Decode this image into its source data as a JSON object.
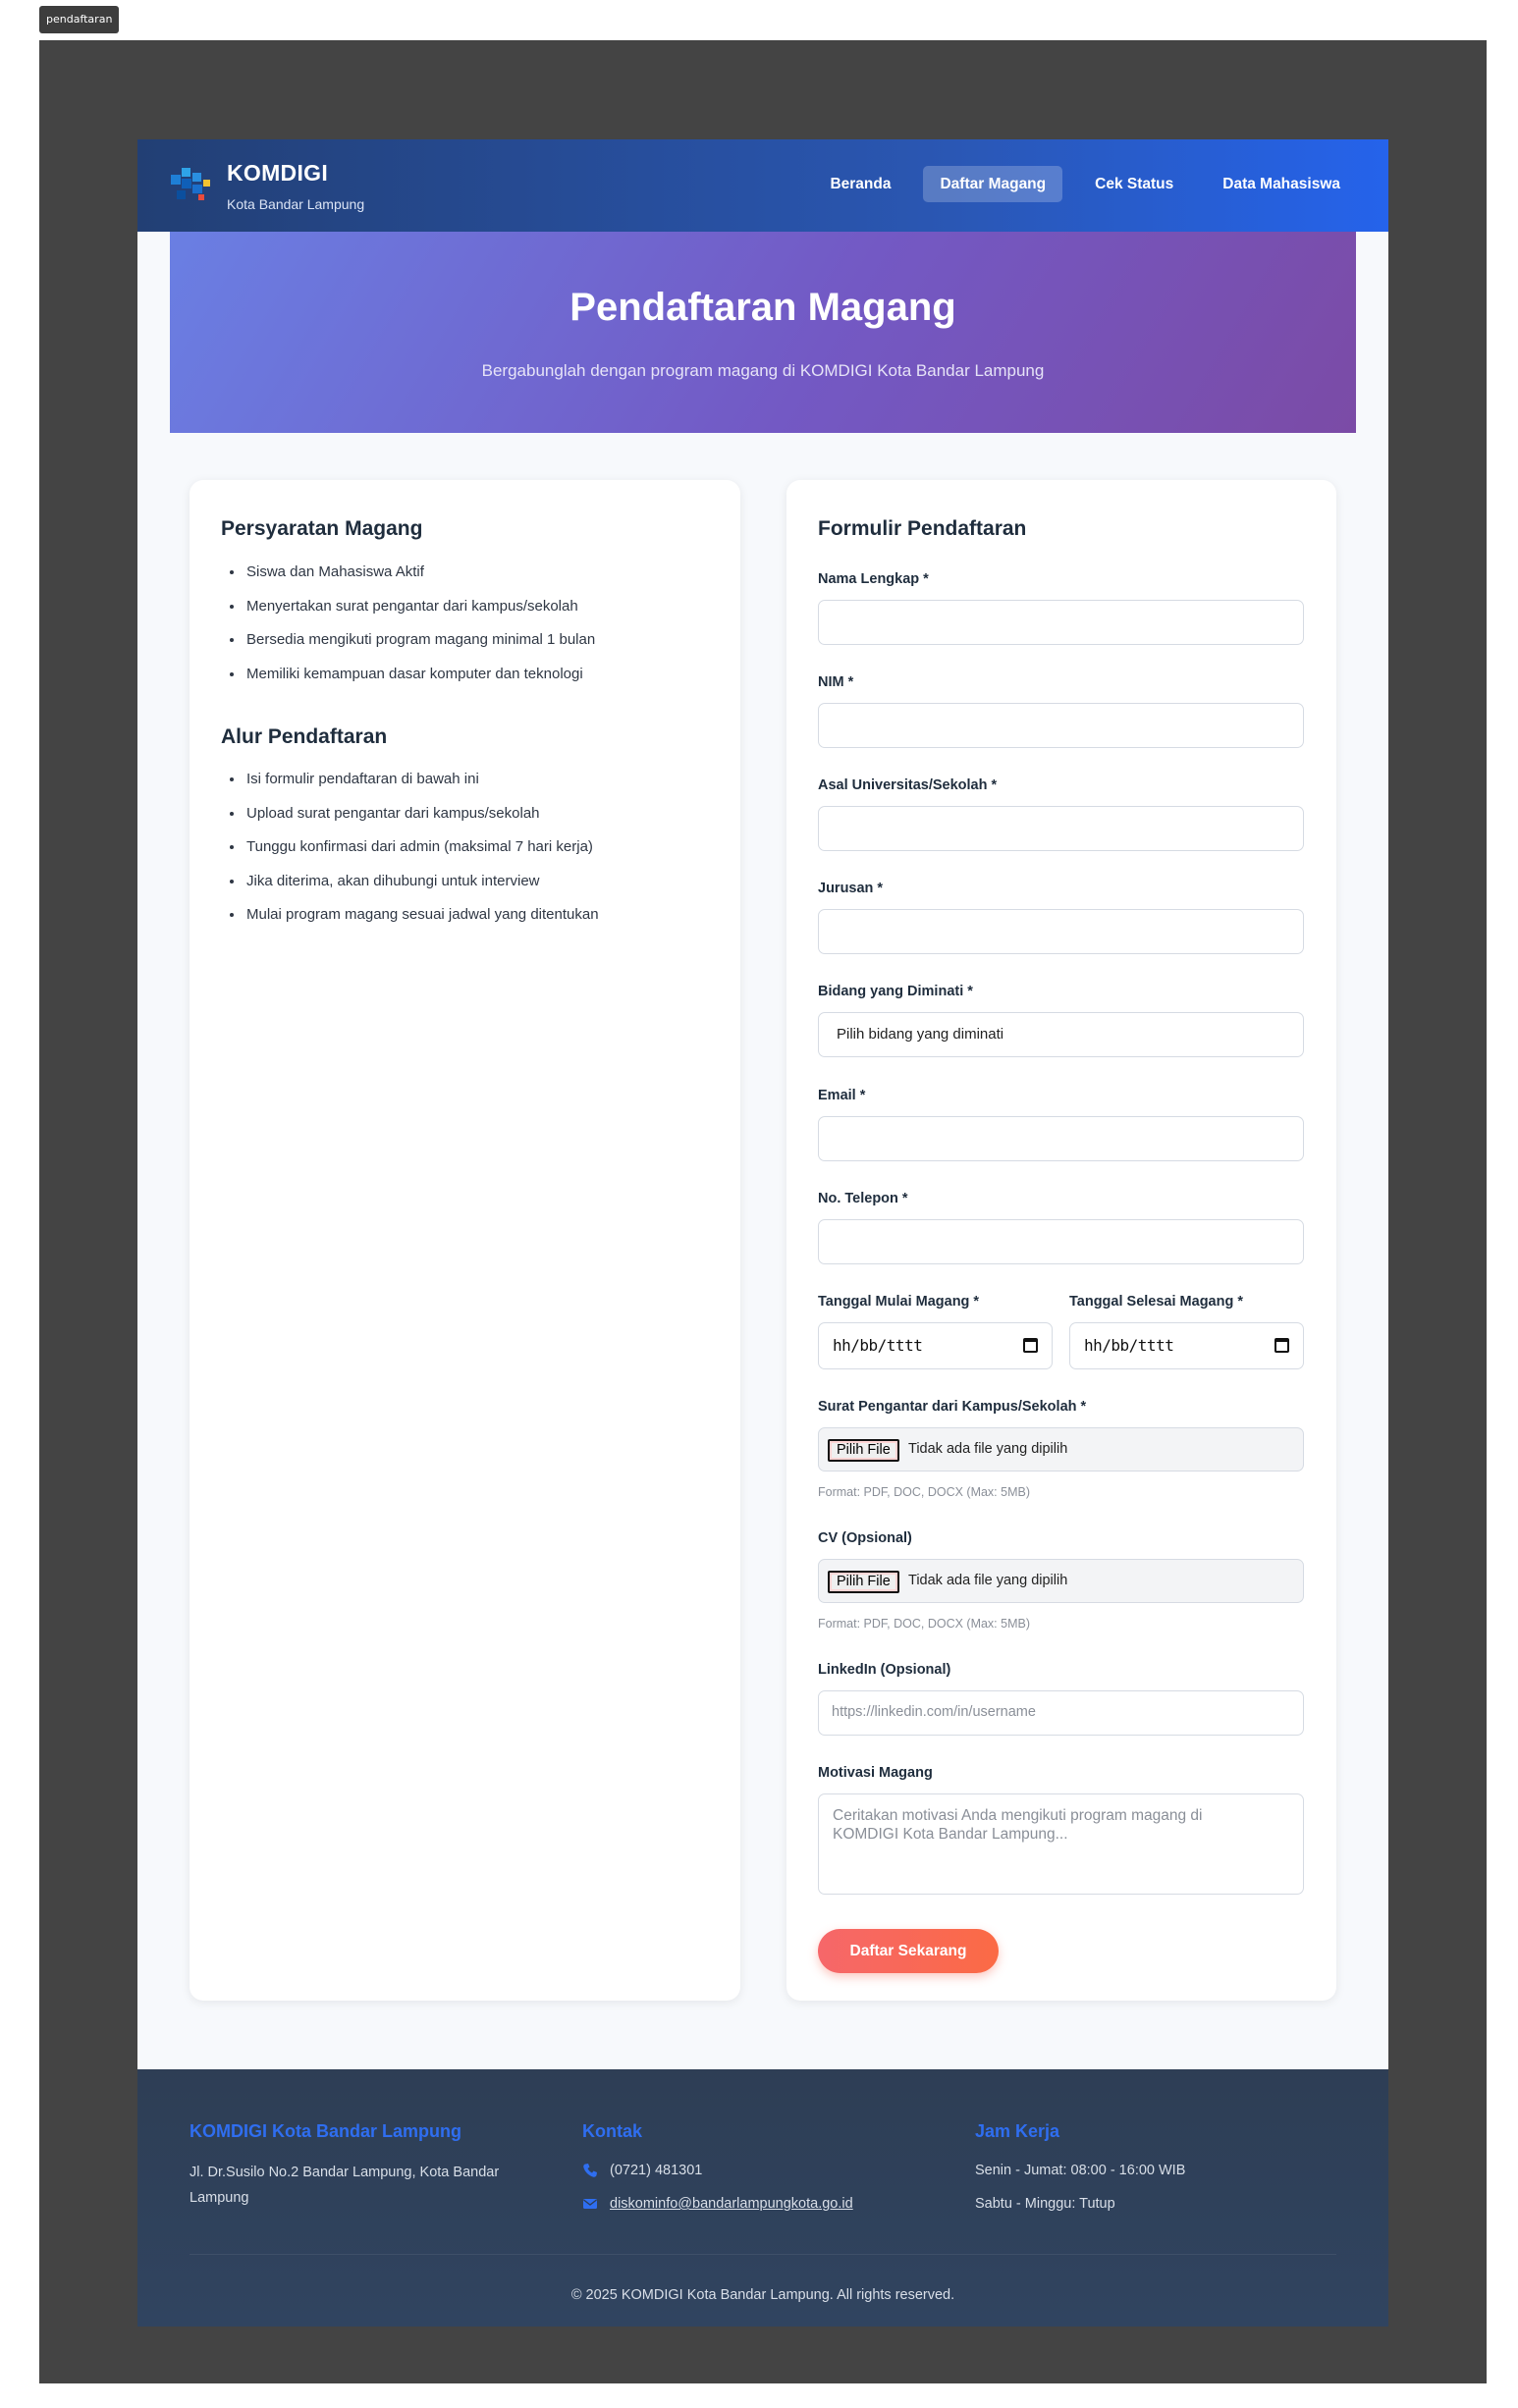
{
  "tab_label": "pendaftaran",
  "header": {
    "brand_name": "KOMDIGI",
    "brand_sub": "Kota Bandar Lampung",
    "nav": [
      "Beranda",
      "Daftar Magang",
      "Cek Status",
      "Data Mahasiswa"
    ],
    "active_nav": "Daftar Magang"
  },
  "hero": {
    "title": "Pendaftaran Magang",
    "subtitle": "Bergabunglah dengan program magang di KOMDIGI Kota Bandar Lampung"
  },
  "requirements": {
    "title": "Persyaratan Magang",
    "items": [
      "Siswa dan Mahasiswa Aktif",
      "Menyertakan surat pengantar dari kampus/sekolah",
      "Bersedia mengikuti program magang minimal 1 bulan",
      "Memiliki kemampuan dasar komputer dan teknologi"
    ]
  },
  "flow": {
    "title": "Alur Pendaftaran",
    "items": [
      "Isi formulir pendaftaran di bawah ini",
      "Upload surat pengantar dari kampus/sekolah",
      "Tunggu konfirmasi dari admin (maksimal 7 hari kerja)",
      "Jika diterima, akan dihubungi untuk interview",
      "Mulai program magang sesuai jadwal yang ditentukan"
    ]
  },
  "form": {
    "title": "Formulir Pendaftaran",
    "nama_label": "Nama Lengkap *",
    "nim_label": "NIM *",
    "asal_label": "Asal Universitas/Sekolah *",
    "jurusan_label": "Jurusan *",
    "bidang_label": "Bidang yang Diminati *",
    "bidang_value": "Pilih bidang yang diminati",
    "email_label": "Email *",
    "telepon_label": "No. Telepon *",
    "mulai_label": "Tanggal Mulai Magang *",
    "selesai_label": "Tanggal Selesai Magang *",
    "date_placeholder": "hh/bb/tttt",
    "surat_label": "Surat Pengantar dari Kampus/Sekolah *",
    "cv_label": "CV (Opsional)",
    "file_button": "Pilih File",
    "file_empty": "Tidak ada file yang dipilih",
    "file_hint": "Format: PDF, DOC, DOCX (Max: 5MB)",
    "linkedin_label": "LinkedIn (Opsional)",
    "linkedin_placeholder": "https://linkedin.com/in/username",
    "motivasi_label": "Motivasi Magang",
    "motivasi_placeholder": "Ceritakan motivasi Anda mengikuti program magang di KOMDIGI Kota Bandar Lampung...",
    "submit_label": "Daftar Sekarang"
  },
  "footer": {
    "org_title": "KOMDIGI Kota Bandar Lampung",
    "address": "Jl. Dr.Susilo No.2 Bandar Lampung, Kota Bandar Lampung",
    "contact_title": "Kontak",
    "phone": "(0721) 481301",
    "email": "diskominfo@bandarlampungkota.go.id",
    "hours_title": "Jam Kerja",
    "weekday_hours": "Senin - Jumat: 08:00 - 16:00 WIB",
    "weekend_hours": "Sabtu - Minggu: Tutup",
    "copyright": "© 2025 KOMDIGI Kota Bandar Lampung. All rights reserved."
  },
  "colors": {
    "accent": "#2563eb",
    "submit": "#f6676a",
    "footer_bg": "#2e3e55"
  }
}
